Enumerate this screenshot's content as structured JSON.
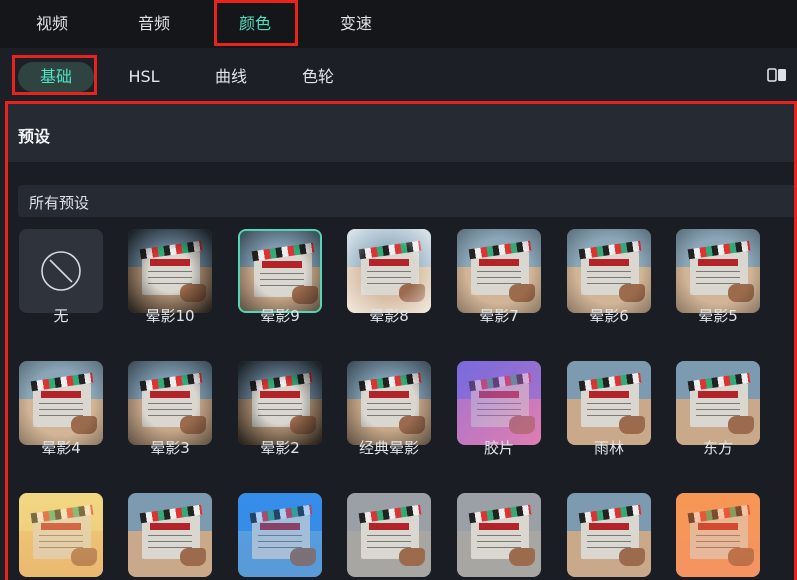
{
  "tabs": [
    {
      "label": "视频"
    },
    {
      "label": "音频"
    },
    {
      "label": "颜色"
    },
    {
      "label": "变速"
    }
  ],
  "subtabs": [
    {
      "label": "基础"
    },
    {
      "label": "HSL"
    },
    {
      "label": "曲线"
    },
    {
      "label": "色轮"
    }
  ],
  "panel": {
    "title": "预设"
  },
  "dropdown": {
    "value": "所有预设"
  },
  "presets": [
    {
      "label": "无",
      "style": "none"
    },
    {
      "label": "晕影10",
      "style": "vig-heavy"
    },
    {
      "label": "晕影9",
      "style": "vig",
      "selected": true
    },
    {
      "label": "晕影8",
      "style": "vig-white"
    },
    {
      "label": "晕影7",
      "style": "vig-light"
    },
    {
      "label": "晕影6",
      "style": "vig-light"
    },
    {
      "label": "晕影5",
      "style": "vig-light"
    },
    {
      "label": "晕影4",
      "style": "vig-light"
    },
    {
      "label": "晕影3",
      "style": "vig"
    },
    {
      "label": "晕影2",
      "style": "vig-heavy"
    },
    {
      "label": "经典晕影",
      "style": "vig"
    },
    {
      "label": "胶片",
      "style": "film"
    },
    {
      "label": "雨林",
      "style": "normal"
    },
    {
      "label": "东方",
      "style": "normal"
    },
    {
      "label": "",
      "style": "warm"
    },
    {
      "label": "",
      "style": "normal"
    },
    {
      "label": "",
      "style": "blue"
    },
    {
      "label": "",
      "style": "gray"
    },
    {
      "label": "",
      "style": "gray"
    },
    {
      "label": "",
      "style": "normal"
    },
    {
      "label": "",
      "style": "orange"
    }
  ],
  "colors": {
    "accent": "#4fe0c0",
    "highlight": "#e8231e"
  }
}
